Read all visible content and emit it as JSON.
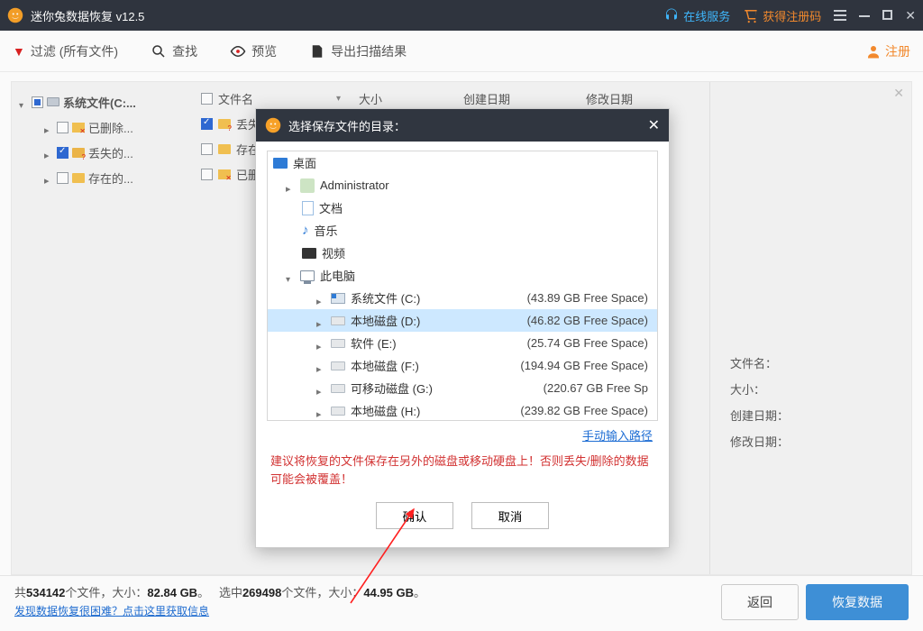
{
  "window": {
    "title": "迷你兔数据恢复 v12.5",
    "online_service": "在线服务",
    "get_reg_code": "获得注册码"
  },
  "toolbar": {
    "filter_label": "过滤",
    "filter_scope": "(所有文件)",
    "find_label": "查找",
    "preview_label": "预览",
    "export_label": "导出扫描结果",
    "register_label": "注册"
  },
  "tree": {
    "root_label": "系统文件(C:...",
    "node_deleted": "已删除...",
    "node_lost": "丢失的...",
    "node_existing": "存在的..."
  },
  "columns": {
    "name": "文件名",
    "size": "大小",
    "created": "创建日期",
    "modified": "修改日期"
  },
  "list": {
    "row_lost_prefix": "丢失",
    "row_existing_prefix": "存在",
    "row_deleted_prefix": "已删"
  },
  "details": {
    "filename_label": "文件名：",
    "size_label": "大小：",
    "created_label": "创建日期：",
    "modified_label": "修改日期："
  },
  "footer": {
    "total_prefix": "共",
    "total_count": "534142",
    "total_mid": "个文件，大小：",
    "total_size": "82.84 GB",
    "sep": "。",
    "sel_prefix": "选中",
    "sel_count": "269498",
    "sel_mid": "个文件，大小：",
    "sel_size": "44.95 GB",
    "help_link": "发现数据恢复很困难？点击这里获取信息",
    "back_btn": "返回",
    "recover_btn": "恢复数据"
  },
  "dialog": {
    "title": "选择保存文件的目录：",
    "desktop": "桌面",
    "admin": "Administrator",
    "documents": "文档",
    "music": "音乐",
    "videos": "视频",
    "this_pc": "此电脑",
    "drives": [
      {
        "label": "系统文件 (C:)",
        "free": "(43.89 GB Free Space)"
      },
      {
        "label": "本地磁盘 (D:)",
        "free": "(46.82 GB Free Space)"
      },
      {
        "label": "软件 (E:)",
        "free": "(25.74 GB Free Space)"
      },
      {
        "label": "本地磁盘 (F:)",
        "free": "(194.94 GB Free Space)"
      },
      {
        "label": "可移动磁盘 (G:)",
        "free": "(220.67 GB Free Sp"
      },
      {
        "label": "本地磁盘 (H:)",
        "free": "(239.82 GB Free Space)"
      }
    ],
    "manual_link": "手动输入路径",
    "warning": "建议将恢复的文件保存在另外的磁盘或移动硬盘上！否则丢失/删除的数据可能会被覆盖！",
    "ok": "确认",
    "cancel": "取消"
  }
}
